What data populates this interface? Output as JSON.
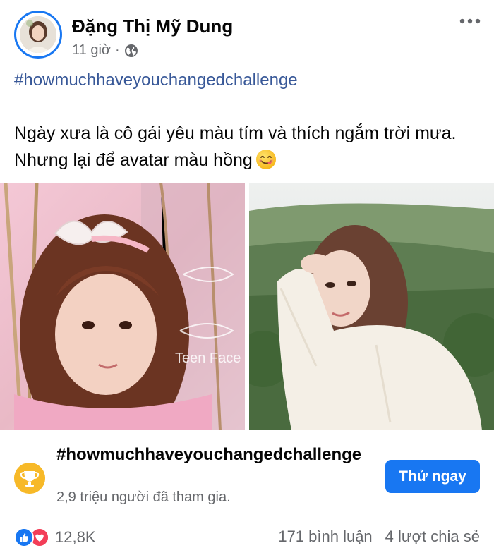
{
  "post": {
    "author": "Đặng Thị Mỹ Dung",
    "time": "11 giờ",
    "separator": "·",
    "privacy_icon": "globe-icon",
    "hashtag": "#howmuchhaveyouchangedchallenge",
    "caption_line1": "Ngày xưa là cô gái yêu màu tím và thích ngắm trời mưa.",
    "caption_line2": "Nhưng lại để avatar màu hồng",
    "caption_emoji": "face-savoring-food-emoji",
    "photos": [
      {
        "name": "photo-then",
        "watermark": "Teen Face"
      },
      {
        "name": "photo-now"
      }
    ]
  },
  "challenge": {
    "icon": "trophy-icon",
    "title": "#howmuchhaveyouchangedchallenge",
    "participants": "2,9 triệu người đã tham gia.",
    "button_label": "Thử ngay"
  },
  "engagement": {
    "reaction_icons": [
      "like-icon",
      "love-icon"
    ],
    "reaction_count": "12,8K",
    "comments": "171 bình luận",
    "shares": "4 lượt chia sẻ"
  },
  "colors": {
    "accent": "#1877f2",
    "hashtag": "#385898",
    "secondary_text": "#65676b",
    "love": "#f33e58",
    "trophy": "#f7b928"
  }
}
